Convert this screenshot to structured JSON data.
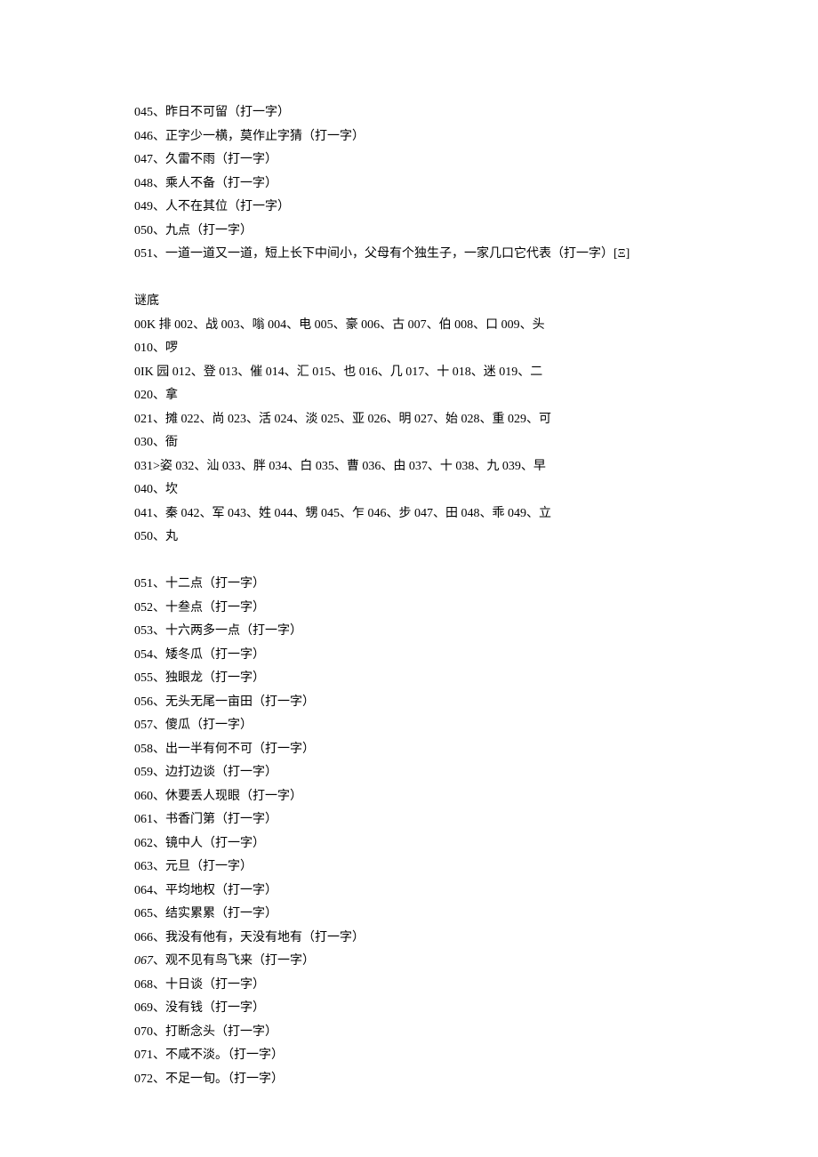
{
  "riddles_top": [
    "045、昨日不可留（打一字）",
    "046、正字少一横，莫作止字猜（打一字）",
    "047、久雷不雨（打一字）",
    "048、乘人不备（打一字）",
    "049、人不在其位（打一字）",
    "050、九点（打一字）",
    "051、一道一道又一道，短上长下中间小，父母有个独生子，一家几口它代表（打一字）[Ξ]"
  ],
  "answers_heading": "谜底",
  "answers": [
    "00K 排 002、战 003、嗡 004、电 005、豪 006、古 007、伯 008、口 009、头",
    "010、啰",
    "0IK 园 012、登 013、催 014、汇 015、也 016、几 017、十 018、迷 019、二",
    "020、拿",
    "021、摊 022、尚 023、活 024、淡 025、亚 026、明 027、始 028、重 029、可",
    "030、衙",
    "031>姿 032、汕 033、胖 034、白 035、曹 036、由 037、十 038、九 039、早",
    "040、坎",
    "041、秦 042、军 043、姓 044、甥 045、乍 046、步 047、田 048、乖 049、立",
    "050、丸"
  ],
  "riddles_bottom": [
    "051、十二点（打一字）",
    "052、十叁点（打一字）",
    "053、十六两多一点（打一字）",
    "054、矮冬瓜（打一字）",
    "055、独眼龙（打一字）",
    "056、无头无尾一亩田（打一字）",
    "057、傻瓜（打一字）",
    "058、出一半有何不可（打一字）",
    "059、边打边谈（打一字）",
    "060、休要丢人现眼（打一字）",
    "061、书香门第（打一字）",
    "062、镜中人（打一字）",
    "063、元旦（打一字）",
    "064、平均地权（打一字）",
    "065、结实累累（打一字）",
    "066、我没有他有，天没有地有（打一字）",
    "068、十日谈（打一字）",
    "069、没有钱（打一字）",
    "070、打断念头（打一字）",
    "071、不咸不淡。（打一字）",
    "072、不足一旬。（打一字）"
  ],
  "riddle_067_prefix": "067",
  "riddle_067_rest": "、观不见有鸟飞来（打一字）"
}
